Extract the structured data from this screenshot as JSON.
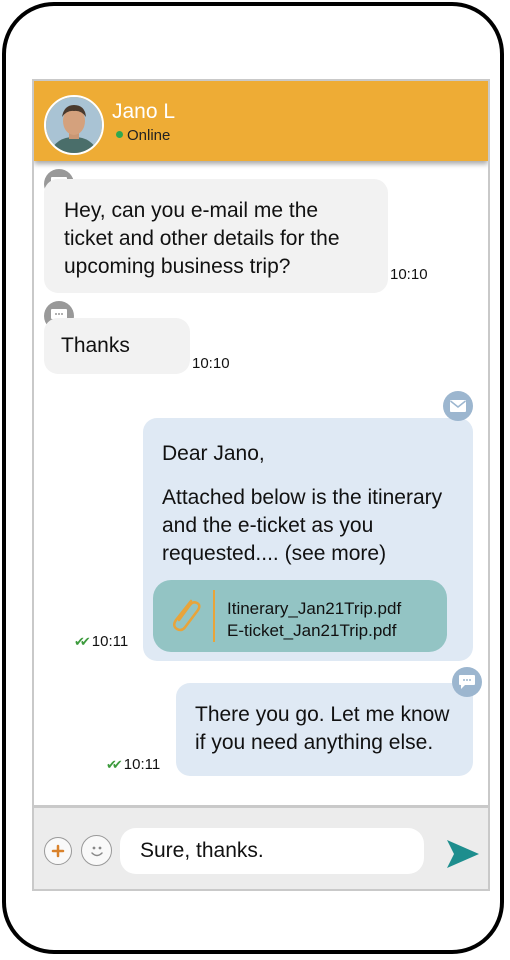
{
  "contact": {
    "name": "Jano L",
    "status": "Online"
  },
  "messages": [
    {
      "direction": "in",
      "type": "chat",
      "text": "Hey, can you e-mail me the ticket and other details for the upcoming business trip?",
      "time": "10:10"
    },
    {
      "direction": "in",
      "type": "chat",
      "text": "Thanks",
      "time": "10:10"
    },
    {
      "direction": "out",
      "type": "email",
      "greeting": "Dear Jano,",
      "body": "Attached below is the itinerary and the e-ticket as you requested.... (see more)",
      "attachments": [
        "Itinerary_Jan21Trip.pdf",
        "E-ticket_Jan21Trip.pdf"
      ],
      "time": "10:11"
    },
    {
      "direction": "out",
      "type": "chat",
      "text": "There you go. Let me know if you need anything else.",
      "time": "10:11"
    }
  ],
  "composer": {
    "value": "Sure, thanks."
  },
  "colors": {
    "header": "#eeac35",
    "incoming": "#f2f2f2",
    "outgoing": "#dfe9f4",
    "attachment": "#93c4c4",
    "send": "#1e8e8e",
    "online": "#2fa84f"
  },
  "icons": {
    "avatar": "contact-photo",
    "chat_badge": "speech-bubble-icon",
    "email_badge": "envelope-icon",
    "attachment": "paperclip-icon",
    "add": "plus-icon",
    "emoji": "smiley-icon",
    "send": "send-arrow-icon",
    "read": "double-check-icon"
  }
}
